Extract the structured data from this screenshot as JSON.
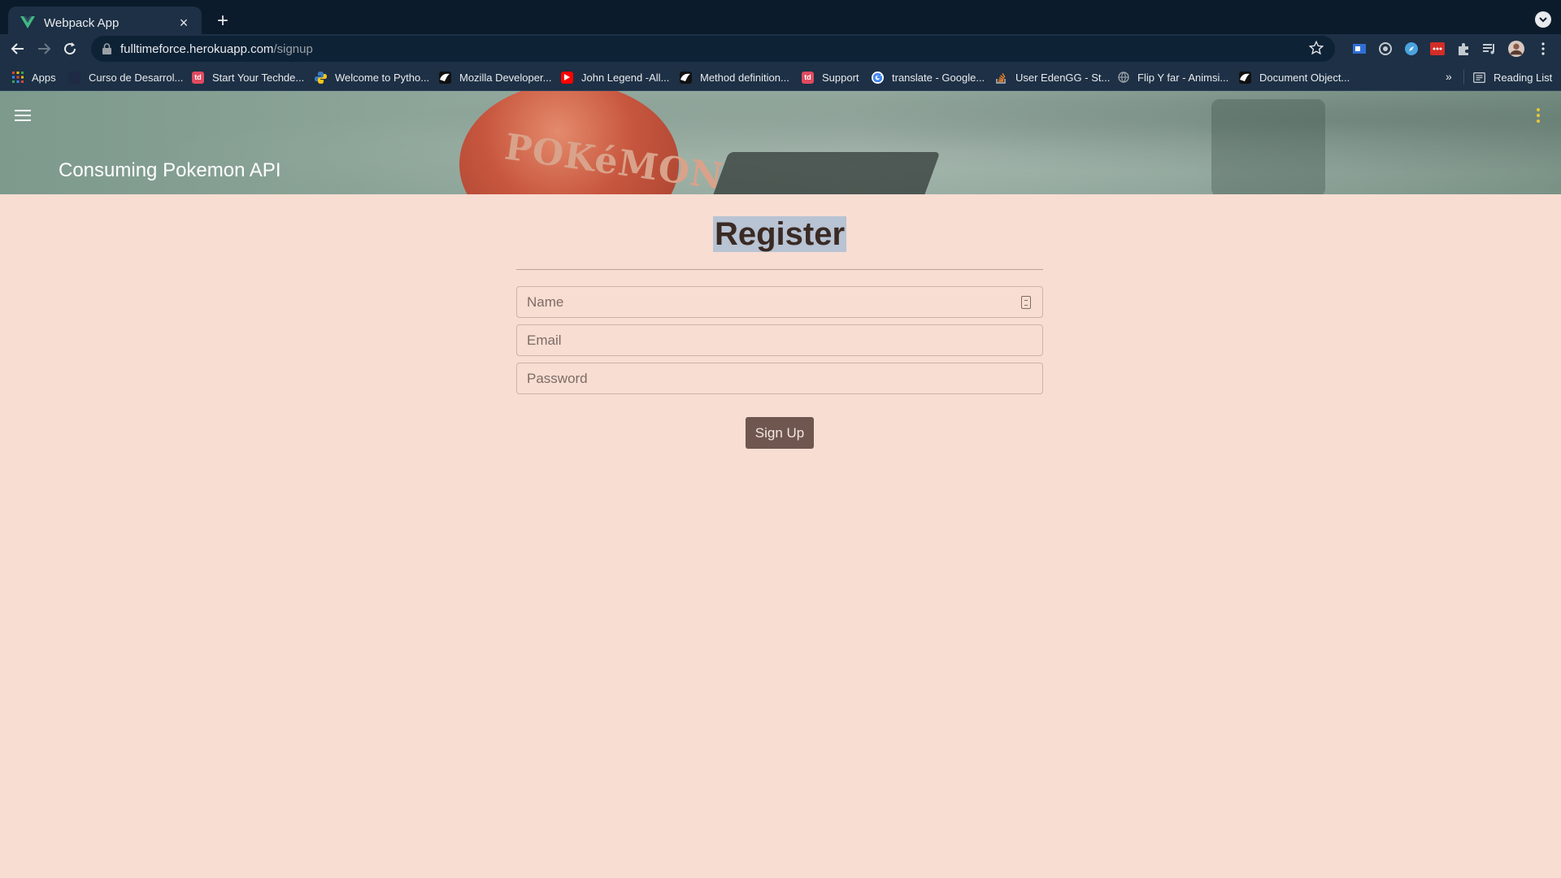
{
  "browser": {
    "tab_title": "Webpack App",
    "tab_close": "×",
    "new_tab": "+",
    "url_host": "fulltimeforce.herokuapp.com",
    "url_path": "/signup",
    "bookmarks": [
      {
        "label": "Apps",
        "icon": "apps-grid-icon",
        "color": "#e8eaed"
      },
      {
        "label": "Curso de Desarrol...",
        "icon": "course-icon",
        "color": "#1f2a44"
      },
      {
        "label": "Start Your Techde...",
        "icon": "techdegree-icon",
        "color": "#e04a5f"
      },
      {
        "label": "Welcome to Pytho...",
        "icon": "python-icon",
        "color": "#f5c518"
      },
      {
        "label": "Mozilla Developer...",
        "icon": "mdn-icon",
        "color": "#111111"
      },
      {
        "label": "John Legend -All...",
        "icon": "youtube-icon",
        "color": "#ff0000"
      },
      {
        "label": "Method definition...",
        "icon": "mdn-icon",
        "color": "#111111"
      },
      {
        "label": "Support",
        "icon": "techdegree-icon",
        "color": "#e04a5f"
      },
      {
        "label": "translate - Google...",
        "icon": "google-icon",
        "color": "#ffffff"
      },
      {
        "label": "User EdenGG - St...",
        "icon": "stackoverflow-icon",
        "color": "#f48024"
      },
      {
        "label": "Flip Y far - Animsi...",
        "icon": "globe-icon",
        "color": "#9aa0a6"
      },
      {
        "label": "Document Object...",
        "icon": "mdn-icon",
        "color": "#111111"
      }
    ],
    "bookmarks_more": "»",
    "reading_list": "Reading List"
  },
  "app": {
    "title": "Consuming Pokemon API",
    "pokeball_text": "POKéMON"
  },
  "form": {
    "heading": "Register",
    "name_placeholder": "Name",
    "email_placeholder": "Email",
    "password_placeholder": "Password",
    "submit_label": "Sign Up"
  },
  "colors": {
    "page_bg": "#f8ddd2",
    "button_bg": "#6f5750",
    "selection": "#b8c3d3"
  }
}
